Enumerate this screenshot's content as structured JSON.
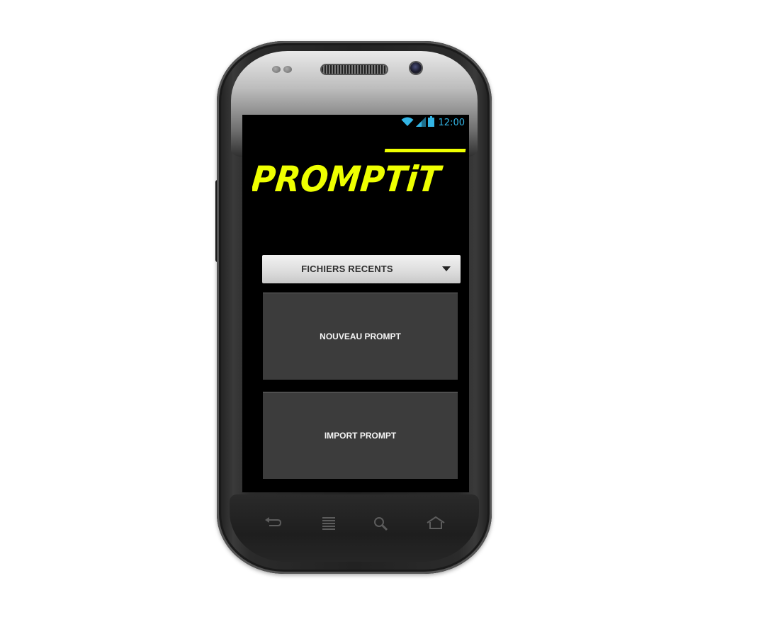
{
  "status_bar": {
    "time": "12:00",
    "icons": [
      "wifi-icon",
      "signal-icon",
      "battery-icon"
    ],
    "accent_color": "#33b5e5"
  },
  "app": {
    "logo_text": "PROMPTiT",
    "logo_color": "#eeff00",
    "background_color": "#000000"
  },
  "recent_files_spinner": {
    "selected_label": "FICHIERS RECENTS",
    "icon": "caret-down-icon"
  },
  "buttons": {
    "new_prompt": "NOUVEAU PROMPT",
    "import_prompt": "IMPORT PROMPT",
    "background_color": "#3c3c3c"
  },
  "device_nav": {
    "keys": [
      "back-icon",
      "menu-icon",
      "search-icon",
      "home-icon"
    ]
  }
}
